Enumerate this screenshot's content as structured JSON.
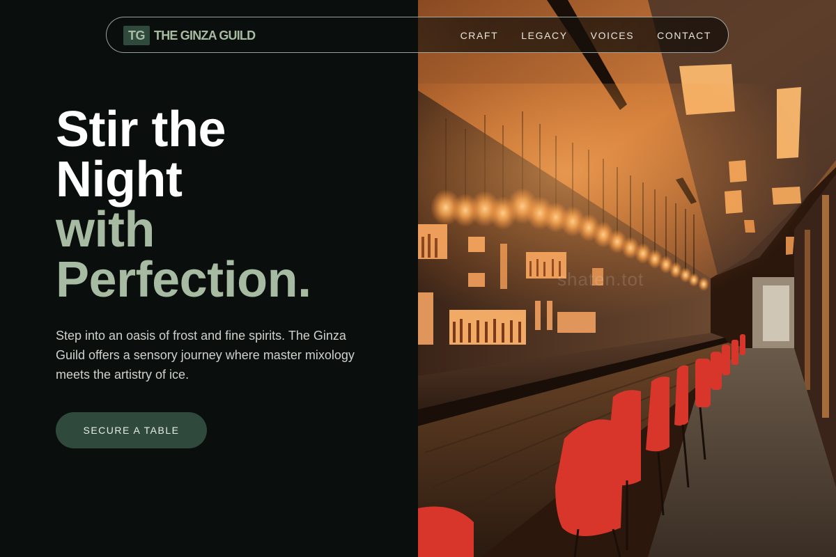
{
  "brand": {
    "mark": "TG",
    "name": "THE GINZA GUILD"
  },
  "nav": {
    "items": [
      {
        "label": "CRAFT"
      },
      {
        "label": "LEGACY"
      },
      {
        "label": "VOICES"
      },
      {
        "label": "CONTACT"
      }
    ]
  },
  "hero": {
    "headline_line1": "Stir the",
    "headline_line2": "Night",
    "headline_line3": "with",
    "headline_line4": "Perfection.",
    "description": "Step into an oasis of frost and fine spirits. The Ginza Guild offers a sensory journey where master mixology meets the artistry of ice.",
    "cta_label": "SECURE A TABLE"
  },
  "image": {
    "watermark": "shaten.tot"
  },
  "colors": {
    "background": "#0a0e0d",
    "accent_green": "#a7bba3",
    "button_green": "#2f4a3d",
    "text_light": "#cfd2cc",
    "bar_stool_red": "#d2372a",
    "warm_light": "#f3a85a"
  },
  "icons": [
    "logo-mark"
  ]
}
